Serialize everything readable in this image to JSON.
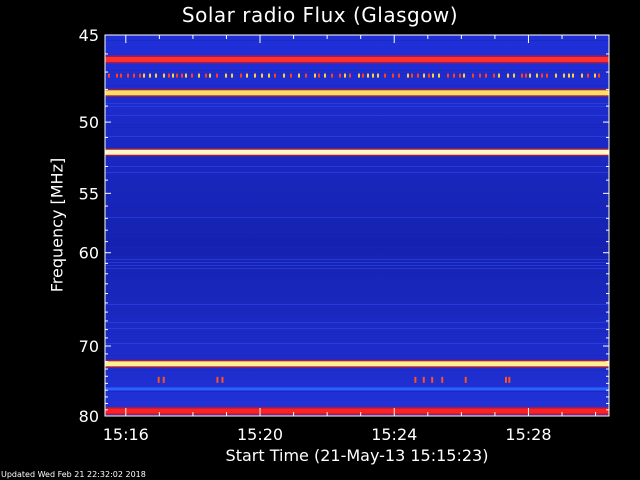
{
  "chart_data": {
    "type": "heatmap",
    "title": "Solar radio Flux (Glasgow)",
    "xlabel": "Start Time (21-May-13 15:15:23)",
    "ylabel": "Frequency [MHz]",
    "x_ticks": [
      "15:16",
      "15:20",
      "15:24",
      "15:28"
    ],
    "x_tick_minutes": [
      16,
      20,
      24,
      28
    ],
    "xlim_minutes": [
      15.38,
      30.4
    ],
    "y_ticks": [
      45,
      50,
      55,
      60,
      70,
      80
    ],
    "ylim": [
      45,
      80
    ],
    "y_scale": "reciprocal",
    "background_color": "#1f2fd0",
    "grid": false,
    "emission_lines": [
      {
        "freq": 46.3,
        "color": "#ff3030",
        "strength": "strong"
      },
      {
        "freq": 48.2,
        "color": "#ffe060",
        "strength": "strong"
      },
      {
        "freq": 52.0,
        "color": "#fff8c0",
        "strength": "strong"
      },
      {
        "freq": 72.3,
        "color": "#fff090",
        "strength": "strong"
      },
      {
        "freq": 75.8,
        "color": "#2a60ff",
        "strength": "weak"
      },
      {
        "freq": 79.2,
        "color": "#ff2020",
        "strength": "strong"
      }
    ]
  },
  "footer": "Updated Wed Feb 21 22:32:02 2018"
}
